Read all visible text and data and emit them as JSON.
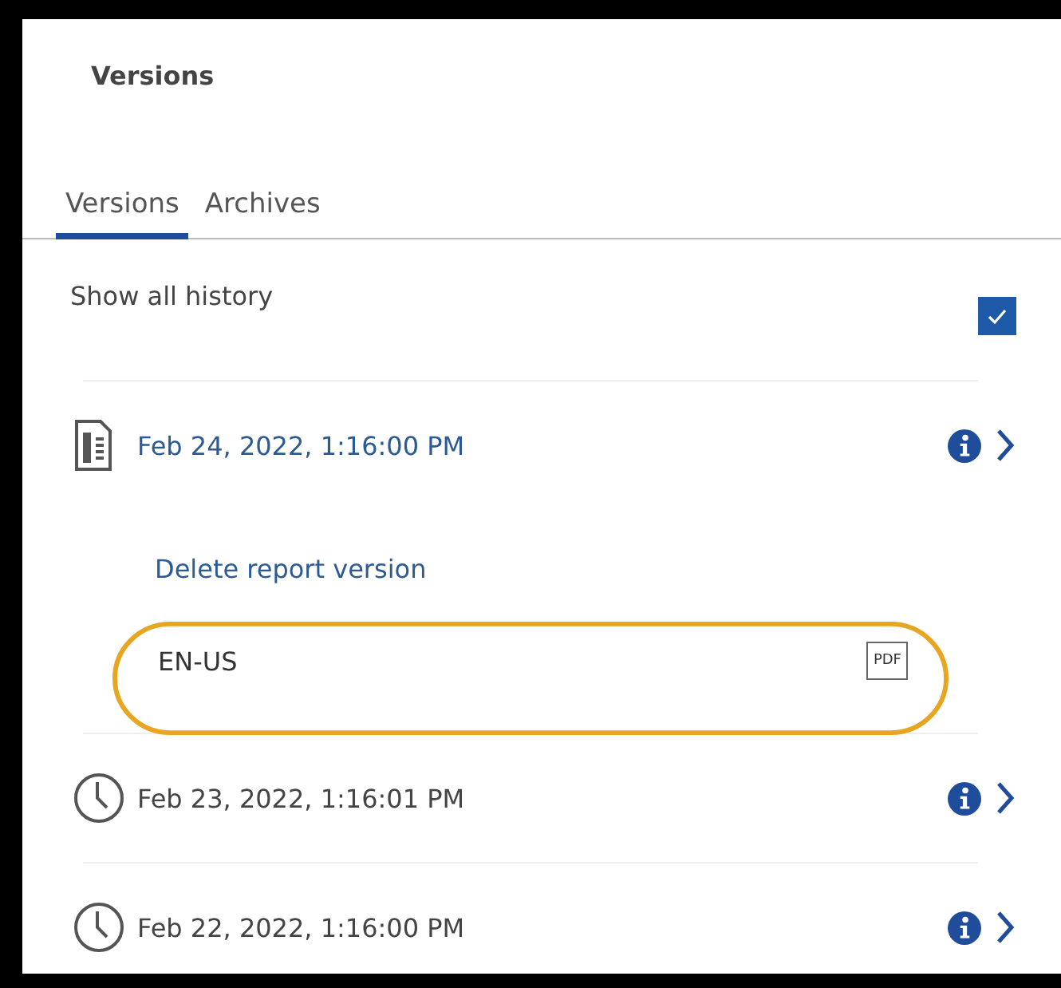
{
  "panel": {
    "title": "Versions"
  },
  "tabs": [
    {
      "label": "Versions",
      "selected": true
    },
    {
      "label": "Archives",
      "selected": false
    }
  ],
  "show_all_history": {
    "label": "Show all history",
    "checked": true
  },
  "versions": [
    {
      "kind": "report",
      "date": "Feb 24, 2022, 1:16:00 PM",
      "expanded": true,
      "action": "Delete report version",
      "outputs": [
        {
          "label": "EN-US",
          "format": "PDF",
          "highlighted": true
        }
      ]
    },
    {
      "kind": "scheduled",
      "date": "Feb 23, 2022, 1:16:01 PM",
      "expanded": false
    },
    {
      "kind": "scheduled",
      "date": "Feb 22, 2022, 1:16:00 PM",
      "expanded": false
    }
  ]
}
